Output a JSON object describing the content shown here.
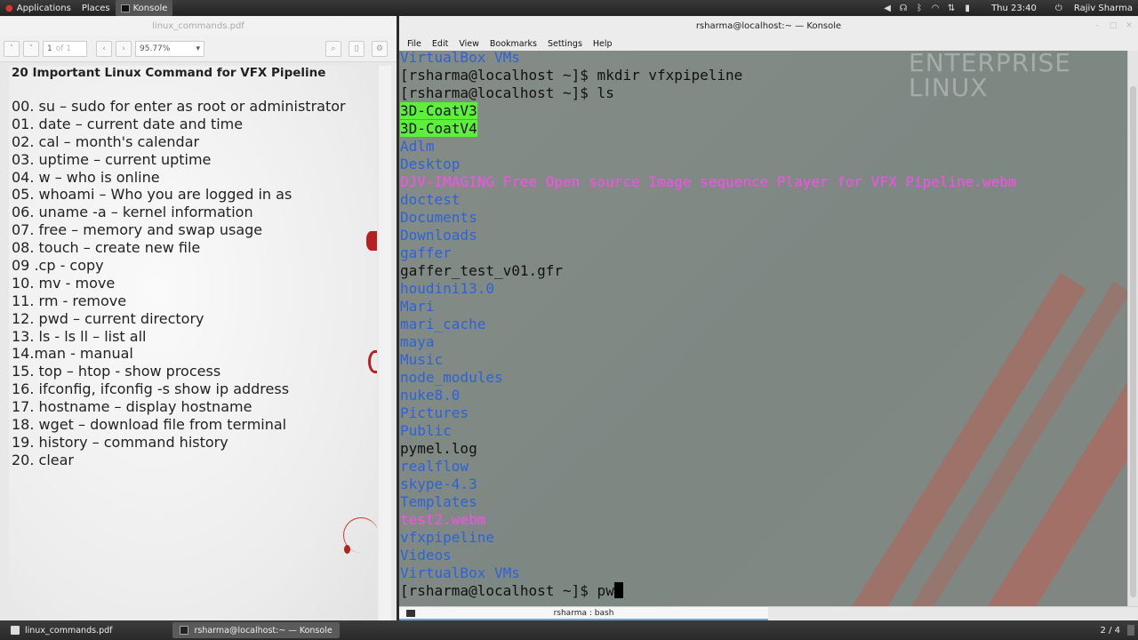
{
  "top_panel": {
    "applications": "Applications",
    "places": "Places",
    "active_app": "Konsole",
    "clock": "Thu 23:40",
    "user": "Rajiv Sharma"
  },
  "pdf": {
    "window_title": "linux_commands.pdf",
    "page_input": "1",
    "page_of": "of 1",
    "zoom": "95.77%",
    "title": "20 Important Linux Command for VFX Pipeline",
    "lines": [
      "00. su – sudo  for enter as root or administrator",
      "01. date – current date and time",
      "02. cal – month's calendar",
      "03. uptime – current uptime",
      "04. w – who is online",
      "05. whoami – Who you are logged in as",
      "06. uname -a – kernel information",
      "07. free – memory and swap usage",
      "08. touch – create new file",
      "09 .cp - copy",
      "10. mv - move",
      "11. rm - remove",
      "12. pwd – current directory",
      "13. ls - ls ll – list all",
      "14.man - manual",
      "15. top – htop  - show process",
      "16. ifconfig,  ifconfig -s  show ip address",
      "17. hostname – display hostname",
      "18. wget – download file from terminal",
      "19. history – command history",
      "20. clear"
    ]
  },
  "konsole": {
    "window_title": "rsharma@localhost:~ — Konsole",
    "menu": [
      "File",
      "Edit",
      "View",
      "Bookmarks",
      "Settings",
      "Help"
    ],
    "tab_label": "rsharma : bash",
    "watermark": [
      "ENTERPRISE",
      "LINUX"
    ],
    "lines": [
      {
        "text": "VirtualBox VMs",
        "type": "dir"
      },
      {
        "text": "[rsharma@localhost ~]$ mkdir vfxpipeline",
        "type": "plain"
      },
      {
        "text": "[rsharma@localhost ~]$ ls",
        "type": "plain"
      },
      {
        "text": "3D-CoatV3",
        "type": "exe"
      },
      {
        "text": "3D-CoatV4",
        "type": "exe"
      },
      {
        "text": "Adlm",
        "type": "dir"
      },
      {
        "text": "Desktop",
        "type": "dir"
      },
      {
        "text": "DJV-IMAGING Free Open source Image sequence Player for VFX Pipeline.webm",
        "type": "media"
      },
      {
        "text": "doctest",
        "type": "dir"
      },
      {
        "text": "Documents",
        "type": "dir"
      },
      {
        "text": "Downloads",
        "type": "dir"
      },
      {
        "text": "gaffer",
        "type": "dir"
      },
      {
        "text": "gaffer_test_v01.gfr",
        "type": "plain"
      },
      {
        "text": "houdini13.0",
        "type": "dir"
      },
      {
        "text": "Mari",
        "type": "dir"
      },
      {
        "text": "mari_cache",
        "type": "dir"
      },
      {
        "text": "maya",
        "type": "dir"
      },
      {
        "text": "Music",
        "type": "dir"
      },
      {
        "text": "node_modules",
        "type": "dir"
      },
      {
        "text": "nuke8.0",
        "type": "dir"
      },
      {
        "text": "Pictures",
        "type": "dir"
      },
      {
        "text": "Public",
        "type": "dir"
      },
      {
        "text": "pymel.log",
        "type": "plain"
      },
      {
        "text": "realflow",
        "type": "dir"
      },
      {
        "text": "skype-4.3",
        "type": "dir"
      },
      {
        "text": "Templates",
        "type": "dir"
      },
      {
        "text": "test2.webm",
        "type": "media"
      },
      {
        "text": "vfxpipeline",
        "type": "dir"
      },
      {
        "text": "Videos",
        "type": "dir"
      },
      {
        "text": "VirtualBox VMs",
        "type": "dir"
      },
      {
        "text": "[rsharma@localhost ~]$ pw",
        "type": "prompt"
      }
    ]
  },
  "taskbar": {
    "items": [
      "linux_commands.pdf",
      "rsharma@localhost:~ — Konsole"
    ],
    "workspace": "2 / 4"
  }
}
